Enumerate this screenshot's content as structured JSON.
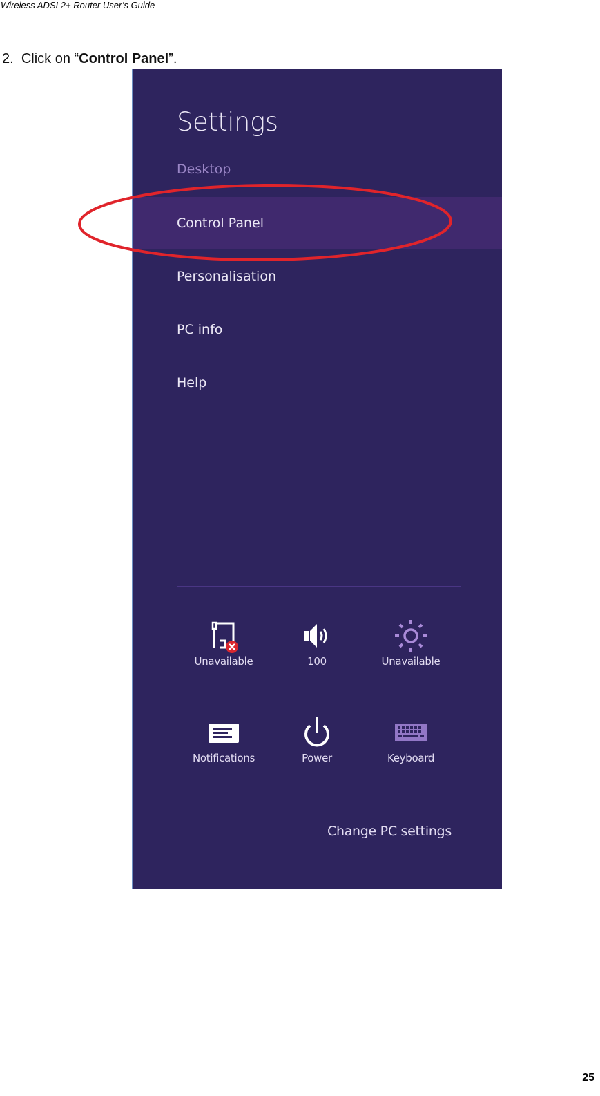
{
  "document": {
    "running_header": "Wireless ADSL2+ Router User’s Guide",
    "step_number": "2.",
    "step_prefix": "Click on “",
    "step_target": "Control Panel",
    "step_suffix": "”.",
    "page_number": "25"
  },
  "settings_panel": {
    "title": "Settings",
    "colors": {
      "background": "#2e245e",
      "selected_row": "#40296e",
      "dim_text": "#9a86c6",
      "highlight_ellipse": "#e0242b"
    },
    "items": [
      {
        "label": "Desktop",
        "state": "dim"
      },
      {
        "label": "Control Panel",
        "state": "selected"
      },
      {
        "label": "Personalisation",
        "state": "normal"
      },
      {
        "label": "PC info",
        "state": "normal"
      },
      {
        "label": "Help",
        "state": "normal"
      }
    ],
    "quick_tiles": [
      {
        "icon": "network-unavailable-icon",
        "label": "Unavailable"
      },
      {
        "icon": "volume-icon",
        "label": "100"
      },
      {
        "icon": "brightness-icon",
        "label": "Unavailable"
      },
      {
        "icon": "notifications-icon",
        "label": "Notifications"
      },
      {
        "icon": "power-icon",
        "label": "Power"
      },
      {
        "icon": "keyboard-icon",
        "label": "Keyboard"
      }
    ],
    "change_pc_settings": "Change PC settings"
  }
}
